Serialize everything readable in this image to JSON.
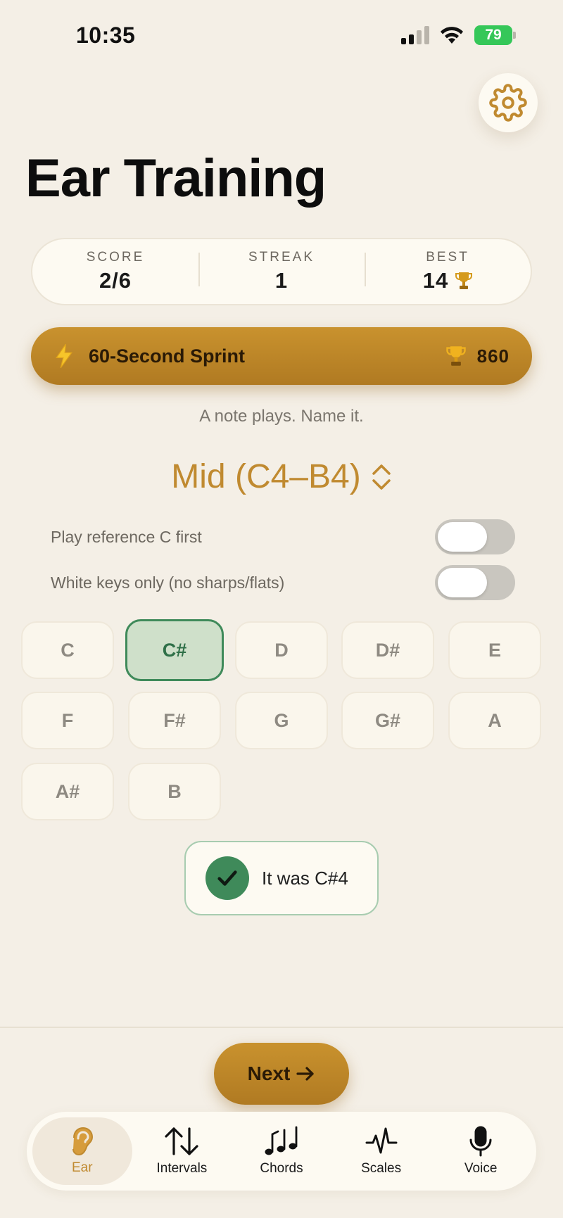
{
  "status_bar": {
    "time": "10:35",
    "battery": "79"
  },
  "header": {
    "title": "Ear Training"
  },
  "stats": [
    {
      "label": "SCORE",
      "value": "2/6"
    },
    {
      "label": "STREAK",
      "value": "1"
    },
    {
      "label": "BEST",
      "value": "14"
    }
  ],
  "sprint": {
    "title": "60-Second Sprint",
    "score": "860"
  },
  "instruction": "A note plays. Name it.",
  "range": {
    "label": "Mid (C4–B4)"
  },
  "toggles": [
    {
      "label": "Play reference C first",
      "on": false
    },
    {
      "label": "White keys only (no sharps/flats)",
      "on": false
    }
  ],
  "notes": [
    "C",
    "C#",
    "D",
    "D#",
    "E",
    "F",
    "F#",
    "G",
    "G#",
    "A",
    "A#",
    "B"
  ],
  "selected_note": "C#",
  "feedback": {
    "text": "It was C#4"
  },
  "next_button": {
    "label": "Next"
  },
  "tabs": [
    {
      "label": "Ear",
      "icon": "ear-icon",
      "active": true
    },
    {
      "label": "Intervals",
      "icon": "arrows-up-down-icon",
      "active": false
    },
    {
      "label": "Chords",
      "icon": "music-notes-icon",
      "active": false
    },
    {
      "label": "Scales",
      "icon": "waveform-icon",
      "active": false
    },
    {
      "label": "Voice",
      "icon": "microphone-icon",
      "active": false
    }
  ],
  "colors": {
    "accent": "#c08a30",
    "success": "#3f8a5a",
    "background": "#f4efe6"
  }
}
